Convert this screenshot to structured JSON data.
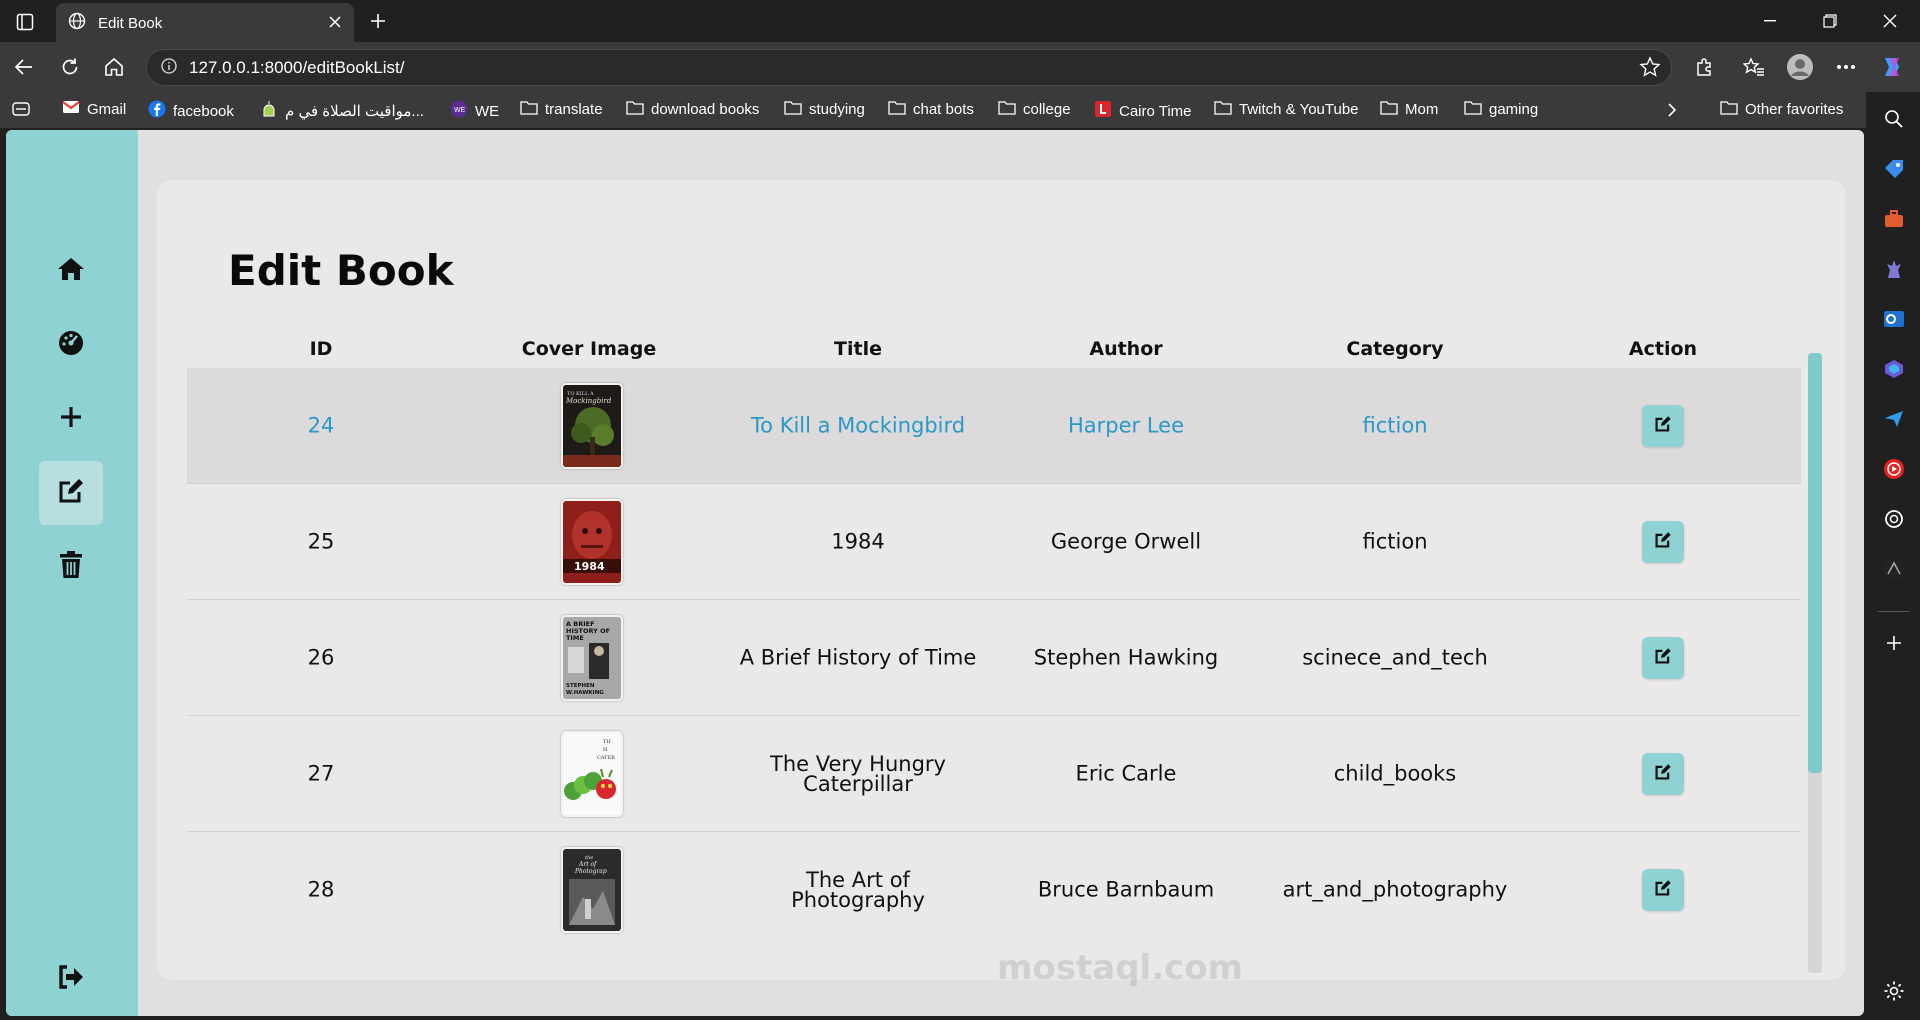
{
  "browser": {
    "tab_title": "Edit Book",
    "url": "127.0.0.1:8000/editBookList/"
  },
  "bookmarks": [
    {
      "label": "Gmail",
      "icon": "gmail-icon"
    },
    {
      "label": "facebook",
      "icon": "facebook-icon"
    },
    {
      "label": "مواقيت الصلاة في م...",
      "icon": "mosque-icon"
    },
    {
      "label": "WE",
      "icon": "we-icon"
    },
    {
      "label": "translate",
      "icon": "folder-icon"
    },
    {
      "label": "download books",
      "icon": "folder-icon"
    },
    {
      "label": "studying",
      "icon": "folder-icon"
    },
    {
      "label": "chat bots",
      "icon": "folder-icon"
    },
    {
      "label": "college",
      "icon": "folder-icon"
    },
    {
      "label": "Cairo Time",
      "icon": "clock-icon"
    },
    {
      "label": "Twitch & YouTube",
      "icon": "folder-icon"
    },
    {
      "label": "Mom",
      "icon": "folder-icon"
    },
    {
      "label": "gaming",
      "icon": "folder-icon"
    }
  ],
  "other_favorites": "Other favorites",
  "page": {
    "title": "Edit Book",
    "columns": [
      "ID",
      "Cover Image",
      "Title",
      "Author",
      "Category",
      "Action"
    ],
    "rows": [
      {
        "id": "24",
        "title": "To Kill a Mockingbird",
        "author": "Harper Lee",
        "category": "fiction",
        "cover": "mockingbird"
      },
      {
        "id": "25",
        "title": "1984",
        "author": "George Orwell",
        "category": "fiction",
        "cover": "1984"
      },
      {
        "id": "26",
        "title": "A Brief History of Time",
        "author": "Stephen Hawking",
        "category": "scinece_and_tech",
        "cover": "brief-history"
      },
      {
        "id": "27",
        "title": "The Very Hungry Caterpillar",
        "author": "Eric Carle",
        "category": "child_books",
        "cover": "caterpillar"
      },
      {
        "id": "28",
        "title": "The Art of Photography",
        "author": "Bruce Barnbaum",
        "category": "art_and_photography",
        "cover": "photography"
      }
    ]
  },
  "colors": {
    "accent": "#8ed2d4",
    "link_hover": "#2a99c9",
    "card": "#ebe8e9",
    "page_bg": "#e2dfdf"
  },
  "watermark": "mostaql.com"
}
